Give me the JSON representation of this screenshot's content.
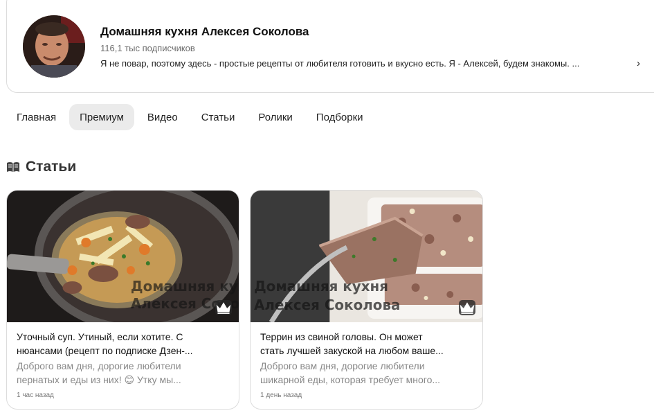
{
  "channel": {
    "title": "Домашняя кухня Алексея Соколова",
    "subscribers": "116,1 тыс подписчиков",
    "description": "Я не повар, поэтому здесь - простые рецепты от любителя готовить и вкусно есть. Я - Алексей, будем знакомы. ...",
    "more_icon": "chevron-right-icon"
  },
  "tabs": [
    {
      "label": "Главная"
    },
    {
      "label": "Премиум"
    },
    {
      "label": "Видео"
    },
    {
      "label": "Статьи"
    },
    {
      "label": "Ролики"
    },
    {
      "label": "Подборки"
    }
  ],
  "active_tab": "Премиум",
  "section": {
    "title": "Статьи",
    "icon": "article-book-icon"
  },
  "articles": [
    {
      "title_line1": "Уточный суп. Утиный, если хотите. С",
      "title_line2": "нюансами (рецепт по подписке Дзен-...",
      "snippet_line1": "Доброго вам дня, дорогие любители",
      "snippet_line2": "пернатых и еды из них! 😊 Утку мы...",
      "time": "1 час назад",
      "watermark_line1": "Домашняя кухня",
      "watermark_line2": "Алексея Соколова",
      "premium_icon": "crown-icon"
    },
    {
      "title_line1": "Террин из свиной головы. Он может",
      "title_line2": "стать лучшей закуской на любом ваше...",
      "snippet_line1": "Доброго вам дня, дорогие любители",
      "snippet_line2": "шикарной еды, которая требует много...",
      "time": "1 день назад",
      "watermark_line1": "Домашняя кухня",
      "watermark_line2": "Алексея Соколова",
      "premium_icon": "crown-icon"
    }
  ],
  "colors": {
    "active_tab_bg": "#ebebeb",
    "border": "#dcdcdc",
    "muted_text": "#888888"
  }
}
